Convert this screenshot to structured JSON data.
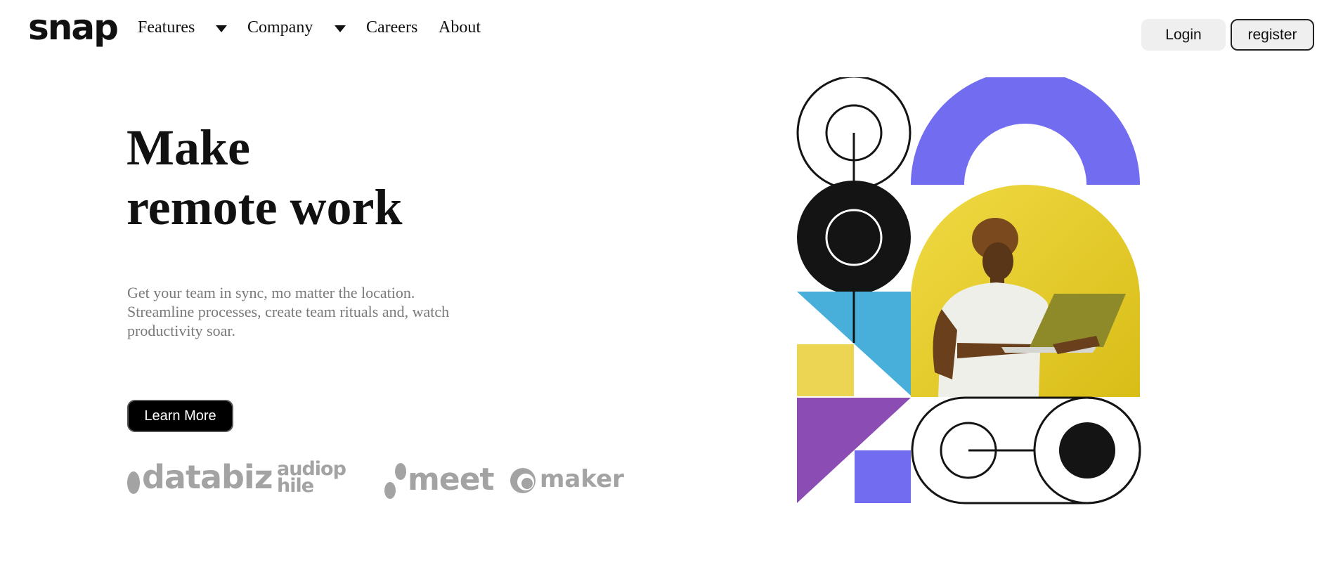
{
  "header": {
    "logo": "snap",
    "nav": [
      {
        "label": "Features",
        "has_dropdown": true
      },
      {
        "label": "Company",
        "has_dropdown": true
      },
      {
        "label": "Careers",
        "has_dropdown": false
      },
      {
        "label": "About",
        "has_dropdown": false
      }
    ],
    "login_label": "Login",
    "register_label": "register"
  },
  "hero": {
    "title_line1": "Make",
    "title_line2": "remote work",
    "description": "Get your team in sync, mo matter the location. Streamline processes, create team rituals and, watch productivity soar.",
    "cta_label": "Learn More"
  },
  "clients": [
    {
      "name": "databiz",
      "icon": "databiz-logo"
    },
    {
      "name": "audiophile",
      "icon": "audiophile-logo"
    },
    {
      "name": "meet",
      "icon": "meet-logo"
    },
    {
      "name": "maker",
      "icon": "maker-logo"
    }
  ],
  "illustration": {
    "icon": "geometric-hero-illustration",
    "colors": {
      "purple": "#726df0",
      "yellow": "#e8d032",
      "blue": "#48afdb",
      "violet": "#8b4cb4",
      "light_yellow": "#ecd552",
      "black": "#141414"
    }
  }
}
